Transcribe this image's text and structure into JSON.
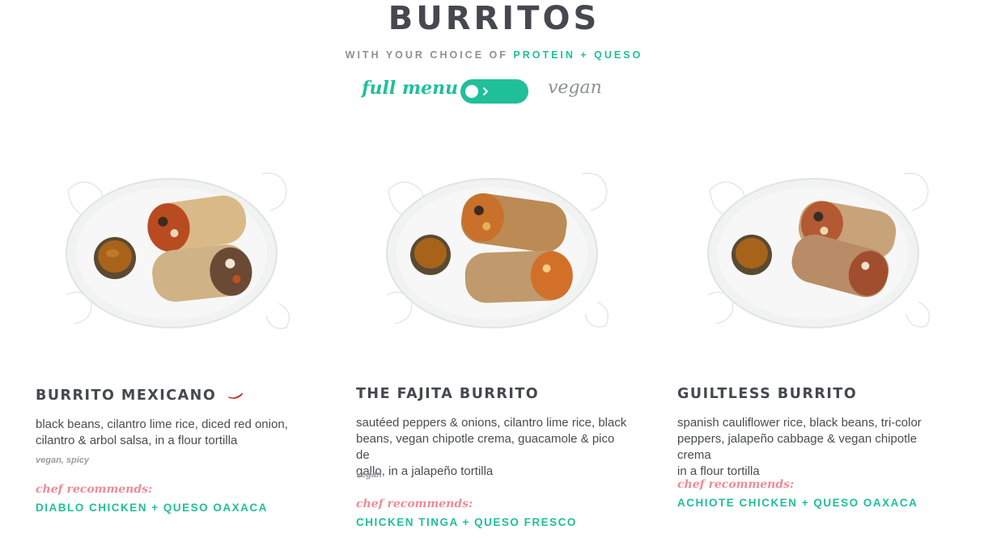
{
  "header": {
    "title": "BURRITOS",
    "subtitle_prefix": "WITH YOUR CHOICE OF",
    "subtitle_accent": "PROTEIN + QUESO"
  },
  "toggle": {
    "left_label": "full menu",
    "right_label": "vegan",
    "state": "full menu"
  },
  "colors": {
    "accent": "#1fbf9a",
    "chef_label": "#ef8a96",
    "heading": "#45484e"
  },
  "items": [
    {
      "name": "BURRITO MEXICANO",
      "icon": "chili-pepper-icon",
      "description_lines": [
        "black beans, cilantro lime rice, diced red onion,",
        "cilantro & arbol salsa, in a flour tortilla"
      ],
      "tags": "vegan, spicy",
      "chef_label": "chef recommends:",
      "chef_pick": "DIABLO CHICKEN + QUESO OAXACA"
    },
    {
      "name": "THE FAJITA BURRITO",
      "description_lines": [
        "sautéed peppers & onions, cilantro lime rice, black",
        "beans, vegan chipotle crema, guacamole & pico de",
        "gallo, in a jalapeño tortilla"
      ],
      "tags": "vegan",
      "chef_label": "chef recommends:",
      "chef_pick": "CHICKEN TINGA + QUESO FRESCO"
    },
    {
      "name": "GUILTLESS BURRITO",
      "description_lines": [
        "spanish cauliflower rice, black beans, tri-color",
        "peppers, jalapeño cabbage & vegan chipotle crema",
        "in a flour tortilla"
      ],
      "chef_label": "chef recommends:",
      "chef_pick": "ACHIOTE CHICKEN + QUESO OAXACA"
    }
  ]
}
